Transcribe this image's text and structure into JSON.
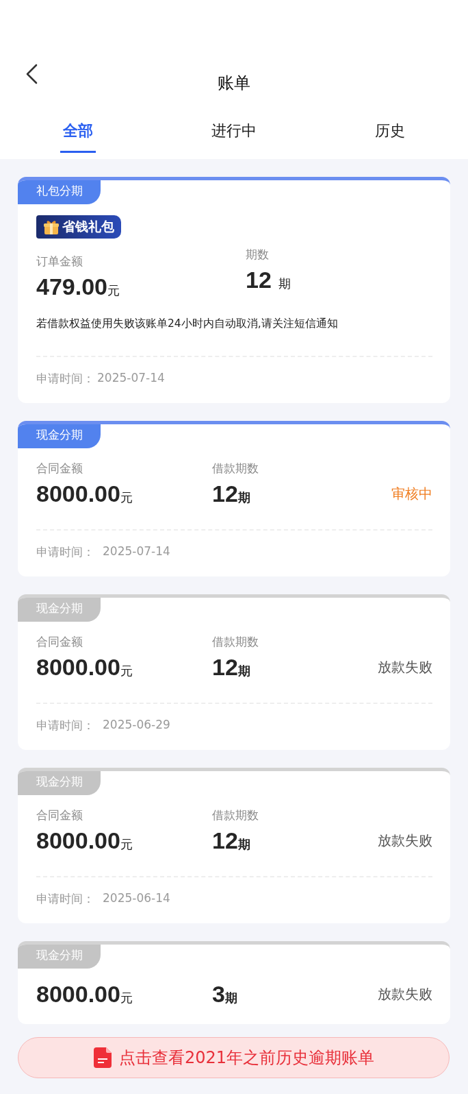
{
  "header": {
    "title": "账单"
  },
  "tabs": [
    {
      "label": "全部",
      "selected": true
    },
    {
      "label": "进行中",
      "selected": false
    },
    {
      "label": "历史",
      "selected": false
    }
  ],
  "cards": [
    {
      "kind": "gift",
      "tag": "礼包分期",
      "active": true,
      "badge": "省钱礼包",
      "amount_label": "订单金额",
      "amount": "479.00",
      "amount_unit": "元",
      "period_label": "期数",
      "period": "12",
      "period_unit": "期",
      "note": "若借款权益使用失败该账单24小时内自动取消,请关注短信通知",
      "date_label": "申请时间：",
      "date": "2025-07-14"
    },
    {
      "kind": "cash",
      "tag": "现金分期",
      "active": true,
      "amount_label": "合同金额",
      "amount": "8000.00",
      "amount_unit": "元",
      "period_label": "借款期数",
      "period": "12",
      "period_unit": "期",
      "status": {
        "text": "审核中",
        "kind": "pending"
      },
      "date_label": "申请时间：",
      "date": "2025-07-14"
    },
    {
      "kind": "cash",
      "tag": "现金分期",
      "active": false,
      "amount_label": "合同金额",
      "amount": "8000.00",
      "amount_unit": "元",
      "period_label": "借款期数",
      "period": "12",
      "period_unit": "期",
      "status": {
        "text": "放款失败",
        "kind": "failed"
      },
      "date_label": "申请时间：",
      "date": "2025-06-29"
    },
    {
      "kind": "cash",
      "tag": "现金分期",
      "active": false,
      "amount_label": "合同金额",
      "amount": "8000.00",
      "amount_unit": "元",
      "period_label": "借款期数",
      "period": "12",
      "period_unit": "期",
      "status": {
        "text": "放款失败",
        "kind": "failed"
      },
      "date_label": "申请时间：",
      "date": "2025-06-14"
    },
    {
      "kind": "cash",
      "tag": "现金分期",
      "active": false,
      "amount": "8000.00",
      "amount_unit": "元",
      "period": "3",
      "period_unit": "期",
      "status": {
        "text": "放款失败",
        "kind": "failed"
      }
    }
  ],
  "banner": {
    "text": "点击查看2021年之前历史逾期账单"
  }
}
